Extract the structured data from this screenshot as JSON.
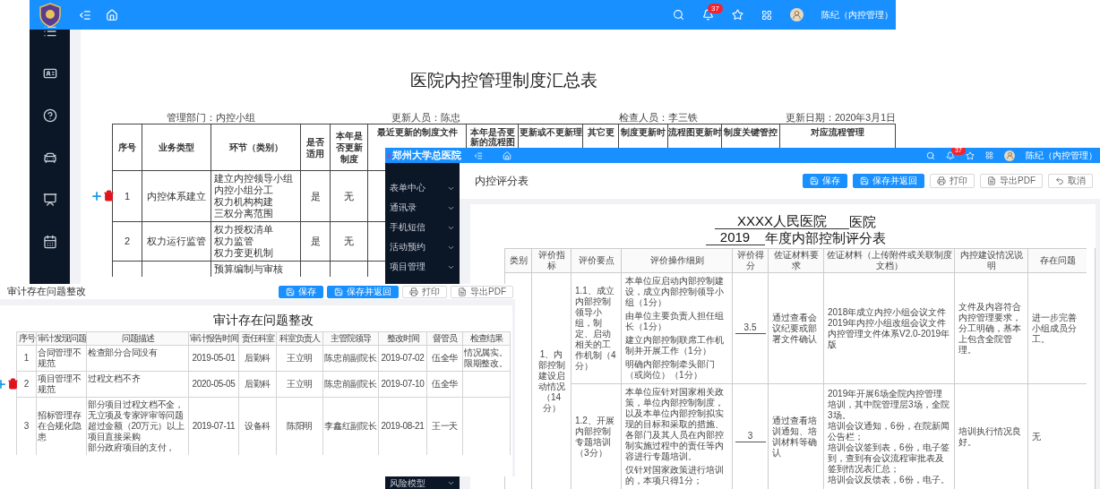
{
  "back_window": {
    "user": "陈纪（内控管理）",
    "notification_count": "37",
    "title": "医院内控管理制度汇总表",
    "meta": [
      {
        "label": "管理部门：",
        "value": "内控小组"
      },
      {
        "label": "更新人员：",
        "value": "陈忠"
      },
      {
        "label": "检查人员：",
        "value": "李三铁"
      },
      {
        "label": "更新日期：",
        "value": "2020年3月1日"
      }
    ],
    "columns": [
      "序号",
      "业务类型",
      "环节（类别）",
      "是否适用",
      "本年是否更新制度",
      "最近更新的制度文件",
      "本年是否更新的流程图",
      "更新或不更新理",
      "其它更",
      "制度更新时",
      "流程图更新时",
      "制度关键管控",
      "对应流程管理"
    ],
    "rows": [
      {
        "index": "1",
        "business_type": "内控体系建立",
        "links": [
          "建立内控领导小组",
          "内控小组分工",
          "权力机构构建",
          "三权分离范围"
        ],
        "applicable": "是",
        "updated": "无",
        "show_actions": true
      },
      {
        "index": "2",
        "business_type": "权力运行监管",
        "links": [
          "权力授权清单",
          "权力监管",
          "权力变更机制"
        ],
        "applicable": "是",
        "updated": "无",
        "show_actions": false
      },
      {
        "links": [
          "预算编制与审核"
        ],
        "show_actions": false
      }
    ]
  },
  "score_window": {
    "brand": "郑州大学总医院",
    "user": "陈纪（内控管理）",
    "notification_count": "37",
    "menu": [
      "表单中心",
      "通讯录",
      "手机短信",
      "活动预约",
      "项目管理",
      "风险模型"
    ],
    "page_title": "内控评分表",
    "buttons": [
      {
        "label": "保存",
        "kind": "save"
      },
      {
        "label": "保存并返回",
        "kind": "save_return"
      },
      {
        "label": "打印",
        "kind": "print"
      },
      {
        "label": "导出PDF",
        "kind": "export"
      },
      {
        "label": "取消",
        "kind": "cancel"
      }
    ],
    "hospital_name": "XXXX人民医院",
    "hospital_suffix": "医院",
    "year": "2019",
    "form_title": "年度内部控制评分表",
    "columns": [
      "类别",
      "评价指标",
      "评价要点",
      "评价操作细则",
      "评价得分",
      "佐证材料要求",
      "佐证材料（上传附件或关联制度文档）",
      "内控建设情况说明",
      "存在问题"
    ],
    "indicator": "1、内部控制建设启动情况（14分）",
    "items": [
      {
        "point": "1.1、成立内部控制领导小组，制定、启动相关的工作机制（4分）",
        "rules": [
          "本单位应启动内部控制建设，成立内部控制领导小组（1分）",
          "由单位主要负责人担任组长（1分）",
          "建立内部控制联席工作机制并开展工作（1分）",
          "明确内部控制牵头部门（或岗位）（1分）"
        ],
        "score": "3.5",
        "requirement": "通过查看会议纪要或部署文件确认",
        "evidence": [
          "2018年成立内控小组会议文件",
          "2019年内控小组改组会议文件",
          "内控管理文件体系V2.0-2019年版"
        ],
        "explanation": "文件及内容符合内控管理要求，分工明确，基本上包含全院管理。",
        "problem": "进一步完善小组成员分工。"
      },
      {
        "point": "1.2、开展内部控制专题培训（3分）",
        "rules": [
          "本单位应针对国家相关政策，单位内部控制制度，以及本单位内部控制拟实现的目标和采取的措施、各部门及其人员在内部控制实施过程中的责任等内容进行专题培训。",
          "仅针对国家政策进行培训的，本项只得1分；"
        ],
        "score": "3",
        "requirement": "通过查看培训通知、培训材料等确认",
        "evidence": [
          "2019年开展6场全院内控管理培训，其中院管理层3场，全院3场。",
          "培训会议通知，6份，在院新闻公告栏；",
          "培训会议签到表，6份，电子签到，查到有会议流程审批表及签到情况表汇总；",
          "培训会议反馈表，6份，电子。"
        ],
        "explanation": "培训执行情况良好。",
        "problem": "无"
      }
    ]
  },
  "audit_window": {
    "page_title": "审计存在问题整改",
    "buttons": [
      {
        "label": "保存",
        "kind": "save"
      },
      {
        "label": "保存并返回",
        "kind": "save_return"
      },
      {
        "label": "打印",
        "kind": "print"
      },
      {
        "label": "导出PDF",
        "kind": "export"
      }
    ],
    "heading": "审计存在问题整改",
    "columns": [
      "序号",
      "审计发现问题",
      "问题描述",
      "审计报告时间",
      "责任科室",
      "科室负责人",
      "主管院领导",
      "整改时间",
      "督管员",
      "检查结果"
    ],
    "rows": [
      {
        "index": "1",
        "issue": "合同管理不规范",
        "description": [
          "检查部分合同没有"
        ],
        "report_date": "2019-05-01",
        "department": "后勤科",
        "dept_head": "王立明",
        "leader": "陈忠前副院长",
        "rectify_date": "2019-07-02",
        "supervisor": "伍全华",
        "result": "情况属实。限期整改。",
        "show_actions": false
      },
      {
        "index": "2",
        "issue": "项目管理不规范",
        "description": [
          "过程文档不齐"
        ],
        "report_date": "2020-05-05",
        "department": "后勤科",
        "dept_head": "王立明",
        "leader": "陈忠前副院长",
        "rectify_date": "2019-07-10",
        "supervisor": "伍全华",
        "show_actions": true
      },
      {
        "index": "3",
        "issue": "招标管理存在合规化隐患",
        "description": [
          "部分项目过程文档不全，无立项及专家评审等问题",
          "超过金额（20万元）以上项目直接采购",
          "部分政府项目的支付，"
        ],
        "report_date": "2019-07-11",
        "department": "设备科",
        "dept_head": "陈阳明",
        "leader": "李鑫红副院长",
        "rectify_date": "2019-08-21",
        "supervisor": "王一天",
        "show_actions": false
      }
    ]
  }
}
